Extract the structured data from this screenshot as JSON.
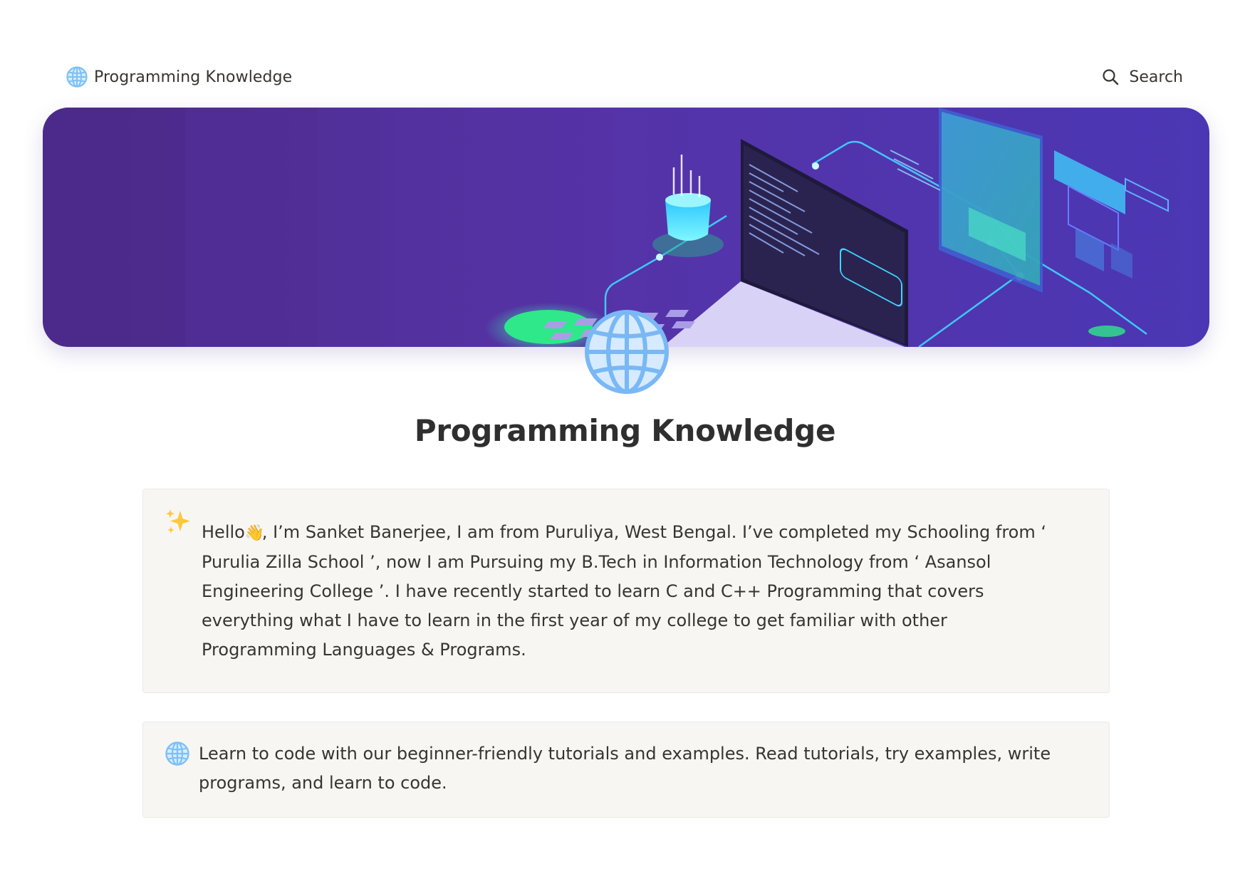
{
  "topbar": {
    "brand_icon": "globe-icon",
    "brand_label": "Programming Knowledge",
    "search_icon": "search-icon",
    "search_label": "Search"
  },
  "cover": {
    "description_icon": "laptop-network-illustration",
    "colors": {
      "background": "#5234a8",
      "accent_cyan": "#3ef0f0",
      "accent_green": "#2ee88a"
    }
  },
  "page": {
    "icon": "globe-icon",
    "title": "Programming Knowledge"
  },
  "callouts": [
    {
      "emoji": "sparkles-icon",
      "lines": [
        {
          "before": "Hello",
          "emoji": "waving-hand-icon",
          "after": ", I’m Sanket Banerjee, I am from Puruliya, West Bengal. I’ve completed my Schooling from ‘"
        },
        {
          "text": "Purulia Zilla School ’, now I am Pursuing my B.Tech in Information Technology from ‘ Asansol"
        },
        {
          "text": "Engineering College ’. I have recently started to learn C and C++ Programming that covers"
        },
        {
          "text": "everything what I have to learn in the first year of my college to get familiar with other"
        },
        {
          "text": "Programming Languages & Programs."
        }
      ]
    },
    {
      "emoji": "globe-icon",
      "lines": [
        {
          "text": "Learn to code with our beginner-friendly tutorials and examples. Read tutorials, try examples, write"
        },
        {
          "text": "programs, and learn to code."
        }
      ]
    }
  ]
}
